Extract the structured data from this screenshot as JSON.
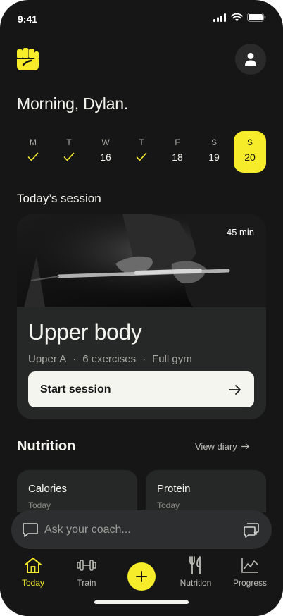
{
  "status_bar": {
    "time": "9:41"
  },
  "header": {
    "greeting": "Morning, Dylan."
  },
  "week": [
    {
      "letter": "M",
      "value": "",
      "done": true
    },
    {
      "letter": "T",
      "value": "",
      "done": true
    },
    {
      "letter": "W",
      "value": "16",
      "done": false
    },
    {
      "letter": "T",
      "value": "",
      "done": true
    },
    {
      "letter": "F",
      "value": "18",
      "done": false
    },
    {
      "letter": "S",
      "value": "19",
      "done": false
    },
    {
      "letter": "S",
      "value": "20",
      "done": false,
      "active": true
    }
  ],
  "session": {
    "section_title": "Today’s session",
    "duration": "45 min",
    "name": "Upper body",
    "meta": [
      "Upper A",
      "6 exercises",
      "Full gym"
    ],
    "meta_separator": "·",
    "start_label": "Start session"
  },
  "nutrition": {
    "title": "Nutrition",
    "view_diary": "View diary",
    "cards": [
      {
        "title": "Calories",
        "subtitle": "Today"
      },
      {
        "title": "Protein",
        "subtitle": "Today"
      }
    ]
  },
  "coach": {
    "placeholder": "Ask your coach..."
  },
  "tabs": [
    {
      "label": "Today",
      "icon": "home-icon",
      "active": true
    },
    {
      "label": "Train",
      "icon": "dumbbell-icon"
    },
    {
      "label": "Nutrition",
      "icon": "fork-knife-icon"
    },
    {
      "label": "Progress",
      "icon": "chart-icon"
    }
  ],
  "colors": {
    "accent": "#f6ec2a",
    "background": "#161616",
    "card": "#262727"
  }
}
